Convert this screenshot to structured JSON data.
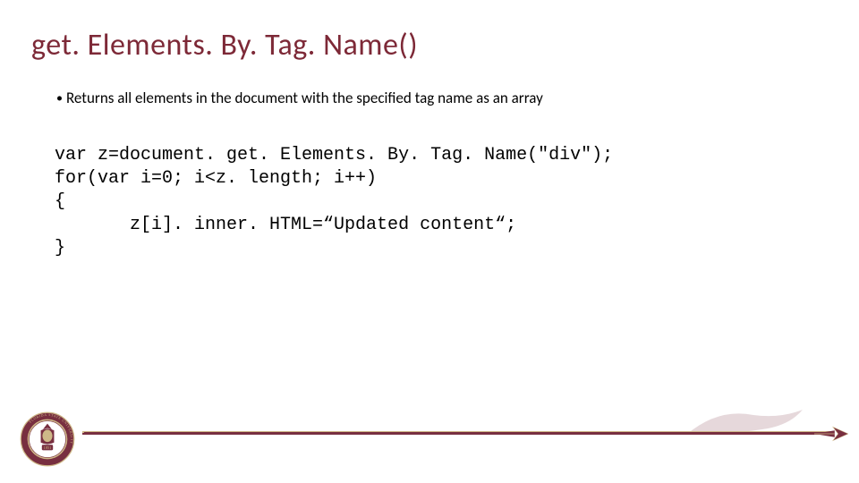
{
  "title": "get. Elements. By. Tag. Name()",
  "bullet": "Returns  all elements in the document with the specified tag name as an array",
  "code": {
    "line1": "var z=document. get. Elements. By. Tag. Name(\"div\");",
    "line2": "for(var i=0; i<z. length; i++)",
    "line3": "{",
    "line4": "       z[i]. inner. HTML=“Updated content“;",
    "line5": "}"
  },
  "seal": {
    "outer_text": "FLORIDA STATE UNIVERSITY",
    "year": "1851"
  },
  "colors": {
    "garnet": "#782f40",
    "gold": "#ceb888",
    "title": "#7d2937"
  }
}
